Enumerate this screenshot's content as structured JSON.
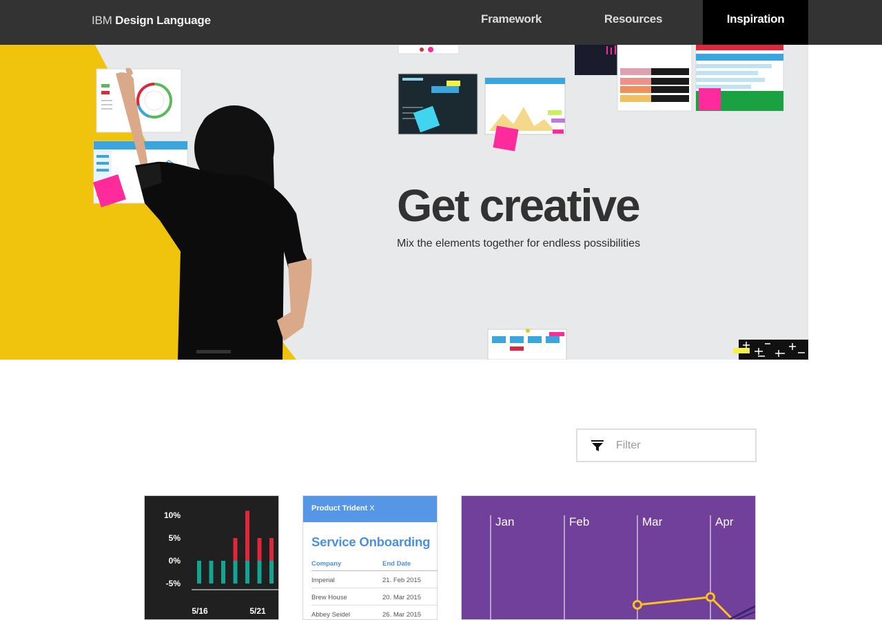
{
  "header": {
    "brand_prefix": "IBM",
    "brand_name": "Design Language",
    "nav": [
      {
        "label": "Framework"
      },
      {
        "label": "Resources"
      },
      {
        "label": "Inspiration",
        "active": true
      }
    ]
  },
  "hero": {
    "title": "Get creative",
    "subtitle": "Mix the elements together for endless possibilities"
  },
  "filter": {
    "icon": "filter-funnel-icon",
    "placeholder": "Filter",
    "value": ""
  },
  "cards": {
    "bar_chart": {
      "ytick_labels": [
        "10%",
        "5%",
        "0%",
        "-5%"
      ],
      "xtick_labels": [
        "5/16",
        "5/21"
      ]
    },
    "table_card": {
      "product": "Product Trident",
      "product_suffix": "X",
      "title": "Service Onboarding",
      "columns": [
        "Company",
        "End Date"
      ],
      "rows": [
        [
          "Imperial",
          "21. Feb 2015"
        ],
        [
          "Brew House",
          "20. Mar 2015"
        ],
        [
          "Abbey Seidel",
          "26. Mar 2015"
        ]
      ]
    },
    "line_chart": {
      "months": [
        "Jan",
        "Feb",
        "Mar",
        "Apr"
      ]
    }
  },
  "colors": {
    "topbar": "#333333",
    "active_nav": "#000000",
    "hero_bg": "#e8e9ea",
    "yellow": "#f0c30c",
    "magenta_note": "#ff2a9c",
    "card_purple": "#71409a",
    "card_dark": "#202020",
    "bar_red": "#e0263c",
    "bar_teal": "#12a594",
    "line_yellow": "#ffc11a",
    "link_blue": "#4a90e2"
  },
  "chart_data": [
    {
      "type": "bar",
      "categories": [
        "5/16",
        "",
        "",
        "",
        "5/21",
        "",
        ""
      ],
      "series": [
        {
          "values": [
            -5,
            -5,
            -5,
            -5,
            -5,
            -5,
            -5
          ]
        },
        {
          "values": [
            0,
            0,
            0,
            5,
            11,
            5,
            5
          ]
        }
      ],
      "yticks": [
        "10%",
        "5%",
        "0%",
        "-5%"
      ],
      "xticks": [
        "5/16",
        "5/21"
      ],
      "ylim": [
        -5,
        11
      ],
      "grid": false
    },
    {
      "type": "line",
      "x": [
        "Mar",
        "Apr"
      ],
      "y": [
        40,
        65
      ],
      "xtick_labels": [
        "Jan",
        "Feb",
        "Mar",
        "Apr"
      ],
      "ylim": [
        0,
        100
      ],
      "grid": true
    }
  ]
}
